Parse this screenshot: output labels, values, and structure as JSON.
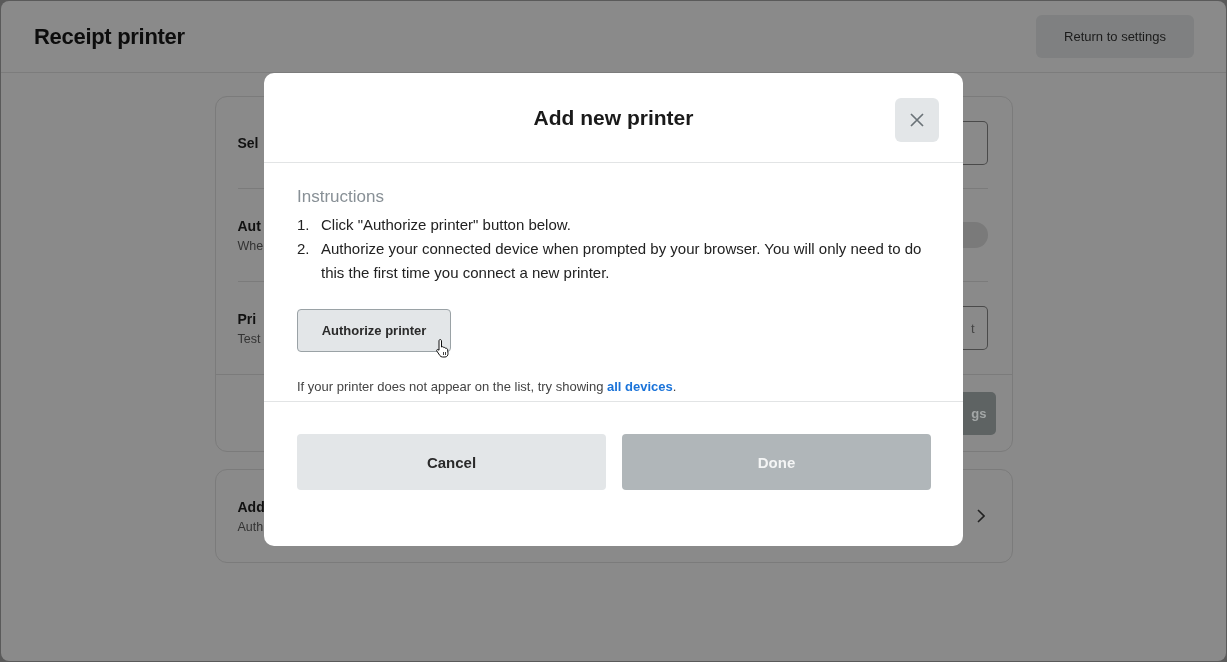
{
  "header": {
    "title": "Receipt printer",
    "button": "Return to settings"
  },
  "settings_card": {
    "rows": [
      {
        "kind": "field",
        "label": "Sel"
      },
      {
        "kind": "toggle",
        "label": "Aut",
        "description": "Whe",
        "on": false
      },
      {
        "kind": "button",
        "label": "Pri",
        "description": "Test",
        "button": "t"
      }
    ],
    "footer_button": "gs"
  },
  "add_card": {
    "label": "Add",
    "description": "Auth"
  },
  "modal": {
    "title": "Add new printer",
    "section_title": "Instructions",
    "steps": [
      {
        "number": "1.",
        "text": "Click \"Authorize printer\" button below."
      },
      {
        "number": "2.",
        "text": "Authorize your connected device when prompted by your browser. You will only need to do this the first time you connect a new printer."
      }
    ],
    "authorize_button": "Authorize printer",
    "note": "If your printer does not appear on the list, try showing ",
    "note_link": "all devices",
    "note_end": ".",
    "buttons": [
      {
        "label": "Cancel",
        "kind": "secondary",
        "disabled": false
      },
      {
        "label": "Done",
        "kind": "primary",
        "disabled": true
      }
    ]
  }
}
